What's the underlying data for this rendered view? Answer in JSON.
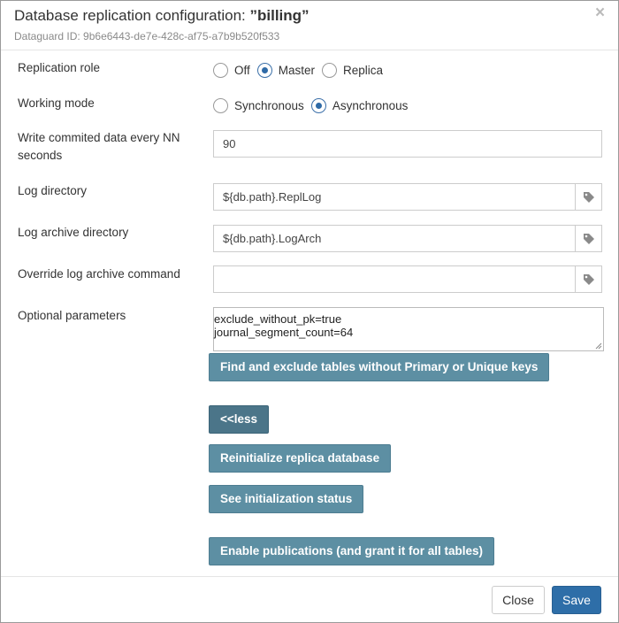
{
  "dialog": {
    "title_prefix": "Database replication configuration: ",
    "title_name": "”billing”",
    "subtitle": "Dataguard ID: 9b6e6443-de7e-428c-af75-a7b9b520f533",
    "close_symbol": "×"
  },
  "fields": {
    "replication_role": {
      "label": "Replication role",
      "options": [
        "Off",
        "Master",
        "Replica"
      ],
      "selected": "Master"
    },
    "working_mode": {
      "label": "Working mode",
      "options": [
        "Synchronous",
        "Asynchronous"
      ],
      "selected": "Asynchronous"
    },
    "write_interval": {
      "label": "Write commited data every NN seconds",
      "value": "90"
    },
    "log_directory": {
      "label": "Log directory",
      "value": "${db.path}.ReplLog",
      "icon": "tag-icon"
    },
    "log_archive_directory": {
      "label": "Log archive directory",
      "value": "${db.path}.LogArch",
      "icon": "tag-icon"
    },
    "override_log_archive_command": {
      "label": "Override log archive command",
      "value": "",
      "icon": "tag-icon"
    },
    "optional_parameters": {
      "label": "Optional parameters",
      "value": "exclude_without_pk=true\njournal_segment_count=64"
    }
  },
  "buttons": {
    "find_exclude": "Find and exclude tables without Primary or Unique keys",
    "less": "<<less",
    "reinitialize": "Reinitialize replica database",
    "see_status": "See initialization status",
    "enable_publications": "Enable publications (and grant it for all tables)"
  },
  "footer": {
    "close_label": "Close",
    "save_label": "Save"
  },
  "colors": {
    "action_button": "#5d8fa3",
    "less_button": "#4b7589",
    "primary": "#2e6ea8",
    "radio_checked": "#2f6aa6"
  }
}
